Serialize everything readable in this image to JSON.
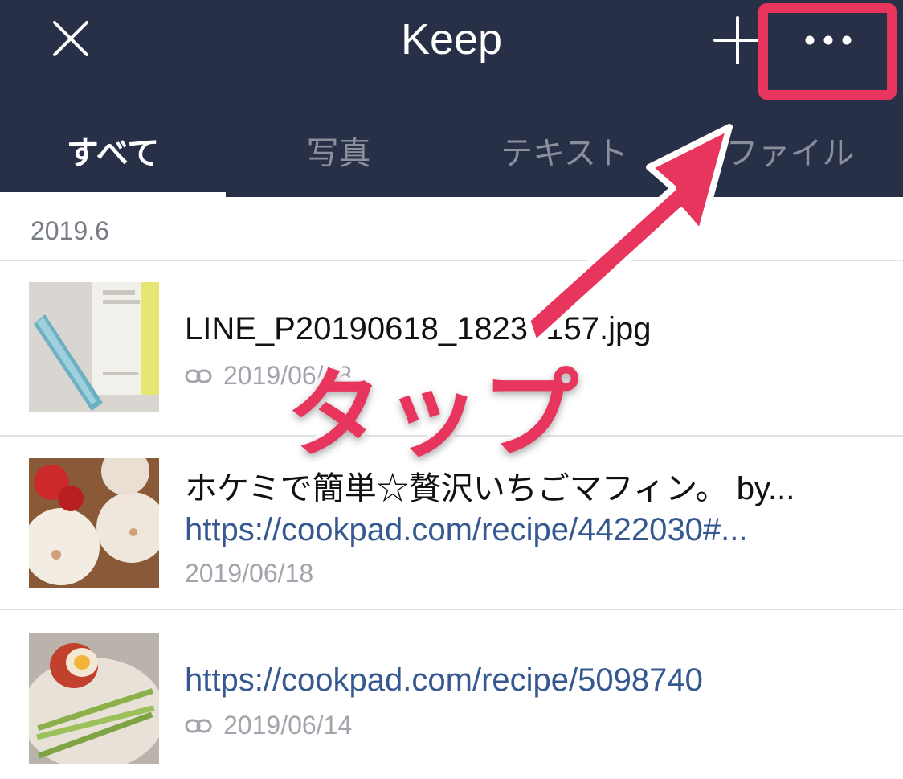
{
  "header": {
    "title": "Keep",
    "accent_color": "#e8355d",
    "background_color": "#283048"
  },
  "tabs": [
    {
      "label": "すべて",
      "active": true
    },
    {
      "label": "写真",
      "active": false
    },
    {
      "label": "テキスト",
      "active": false
    },
    {
      "label": "ファイル",
      "active": false
    }
  ],
  "section": {
    "label": "2019.6"
  },
  "items": [
    {
      "title": "LINE_P20190618_18234157.jpg",
      "meta": "2019/06/18",
      "icon": "link-icon",
      "thumbnail": "product-photo"
    },
    {
      "title": "ホケミで簡単☆贅沢いちごマフィン。 by...",
      "link": "https://cookpad.com/recipe/4422030#...",
      "meta": "2019/06/18",
      "thumbnail": "muffin-photo"
    },
    {
      "link": "https://cookpad.com/recipe/5098740",
      "meta": "2019/06/14",
      "icon": "link-icon",
      "thumbnail": "noodle-photo"
    }
  ],
  "annotation": {
    "text": "タップ"
  }
}
